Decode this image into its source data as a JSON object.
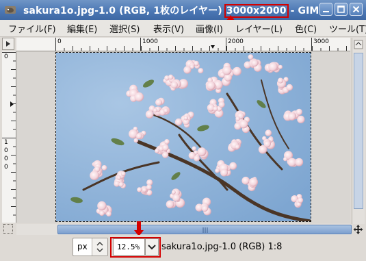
{
  "window": {
    "title_prefix": "sakura1o.jpg-1.0 (RGB, 1枚のレイヤー) ",
    "title_dimensions": "3000x2000",
    "title_suffix": " - GIMP"
  },
  "menu": [
    "ファイル(F)",
    "編集(E)",
    "選択(S)",
    "表示(V)",
    "画像(I)",
    "レイヤー(L)",
    "色(C)",
    "ツール(T)"
  ],
  "ruler": {
    "h_labels": [
      "0",
      "1000",
      "2000",
      "3000"
    ],
    "v_labels": [
      "0",
      "1",
      "0",
      "0",
      "0"
    ]
  },
  "status": {
    "unit": "px",
    "zoom": "12.5%",
    "image_info": "sakura1o.jpg-1.0 (RGB) 1:8"
  },
  "colors": {
    "highlight": "#d40000",
    "titlebar": "#4a76b3",
    "sky": "#8fb3d9"
  }
}
